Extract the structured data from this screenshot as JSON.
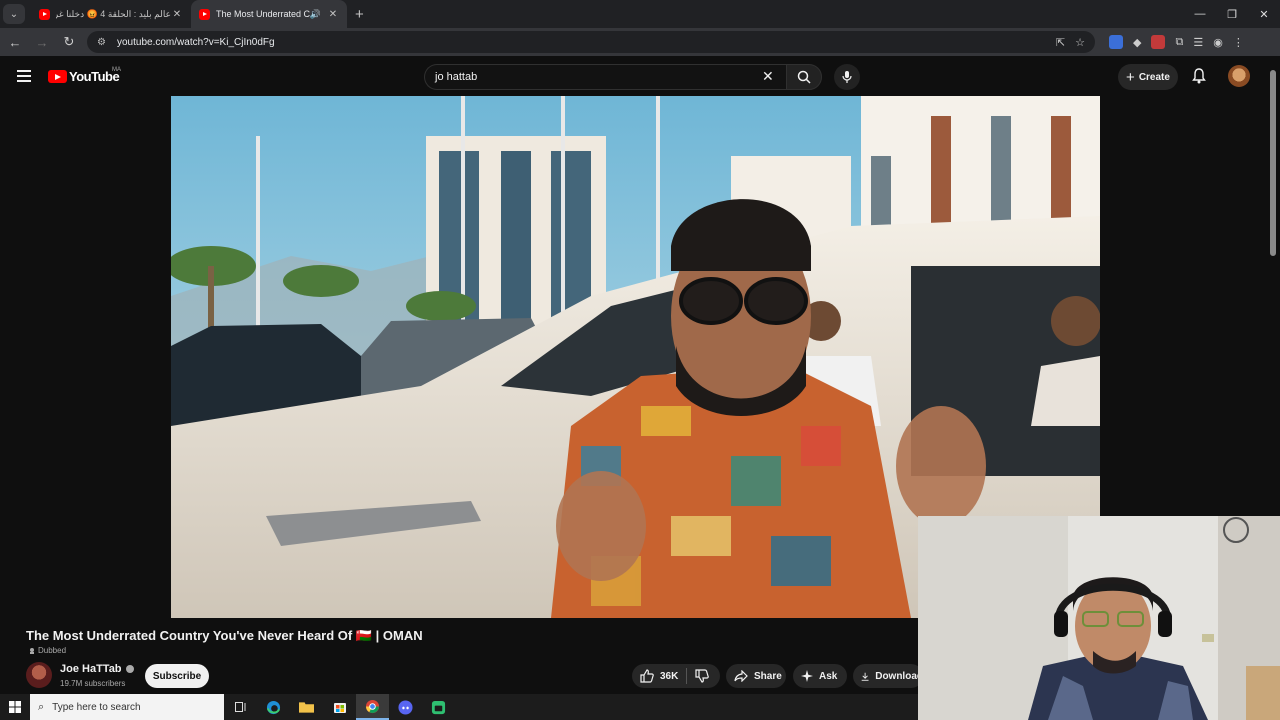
{
  "browser": {
    "tabs": [
      {
        "title": "عالم بليد : الحلقة 4 😡 دخلنا غرفة",
        "active": false
      },
      {
        "title": "The Most Underrated Country",
        "active": true
      }
    ],
    "url": "youtube.com/watch?v=Ki_CjIn0dFg"
  },
  "youtube": {
    "logo_text": "YouTube",
    "country_code": "MA",
    "search_query": "jo hattab",
    "create_label": "Create"
  },
  "video": {
    "title": "The Most Underrated Country You've Never Heard Of 🇴🇲 | OMAN",
    "dubbed_label": "Dubbed",
    "channel_name": "Joe HaTTab",
    "subscribers": "19.7M subscribers",
    "subscribe_label": "Subscribe",
    "likes": "36K",
    "share_label": "Share",
    "ask_label": "Ask",
    "download_label": "Download"
  },
  "taskbar": {
    "search_placeholder": "Type here to search"
  },
  "colors": {
    "youtube_red": "#ff0000",
    "page_bg": "#0f0f0f",
    "chrome_dark": "#202124",
    "chrome_toolbar": "#35363a"
  }
}
